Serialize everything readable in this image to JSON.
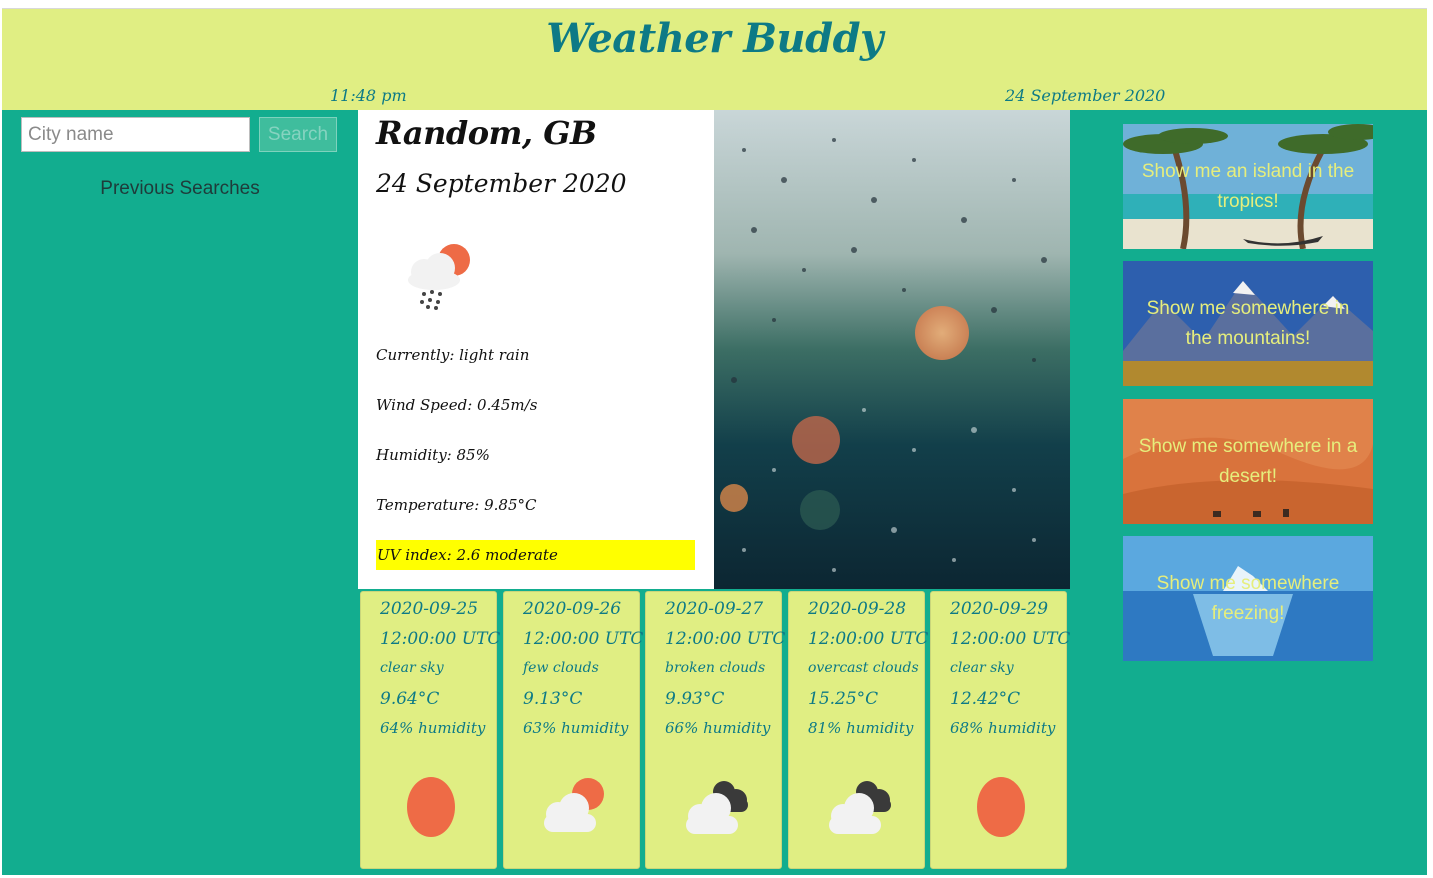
{
  "app": {
    "title": "Weather Buddy",
    "time": "11:48 pm",
    "date": "24 September 2020"
  },
  "sidebar": {
    "search_placeholder": "City name",
    "search_button": "Search",
    "previous_title": "Previous Searches"
  },
  "current": {
    "city": "Random, GB",
    "date": "24 September 2020",
    "icon": "rain-cloud-sun-icon",
    "currently": "Currently: light rain",
    "wind": "Wind Speed: 0.45m/s",
    "humidity": "Humidity: 85%",
    "temperature": "Temperature: 9.85°C",
    "uv": "UV index: 2.6 moderate",
    "uv_color": "#ffff00"
  },
  "forecast": [
    {
      "date": "2020-09-25",
      "time": "12:00:00 UTC",
      "desc": "clear sky",
      "temp": "9.64°C",
      "humidity": "64% humidity",
      "icon": "sun-icon"
    },
    {
      "date": "2020-09-26",
      "time": "12:00:00 UTC",
      "desc": "few clouds",
      "temp": "9.13°C",
      "humidity": "63% humidity",
      "icon": "partly-cloudy-icon"
    },
    {
      "date": "2020-09-27",
      "time": "12:00:00 UTC",
      "desc": "broken clouds",
      "temp": "9.93°C",
      "humidity": "66% humidity",
      "icon": "broken-clouds-icon"
    },
    {
      "date": "2020-09-28",
      "time": "12:00:00 UTC",
      "desc": "overcast clouds",
      "temp": "15.25°C",
      "humidity": "81% humidity",
      "icon": "overcast-clouds-icon"
    },
    {
      "date": "2020-09-29",
      "time": "12:00:00 UTC",
      "desc": "clear sky",
      "temp": "12.42°C",
      "humidity": "68% humidity",
      "icon": "sun-icon"
    }
  ],
  "destinations": [
    {
      "label": "Show me an island in the tropics!"
    },
    {
      "label": "Show me somewhere in the mountains!"
    },
    {
      "label": "Show me somewhere in a desert!"
    },
    {
      "label": "Show me somewhere freezing!"
    }
  ],
  "colors": {
    "header": "#e0ee83",
    "background": "#12ad8f",
    "accent_text": "#0d7a86",
    "tile_text": "#e6ee7c"
  }
}
